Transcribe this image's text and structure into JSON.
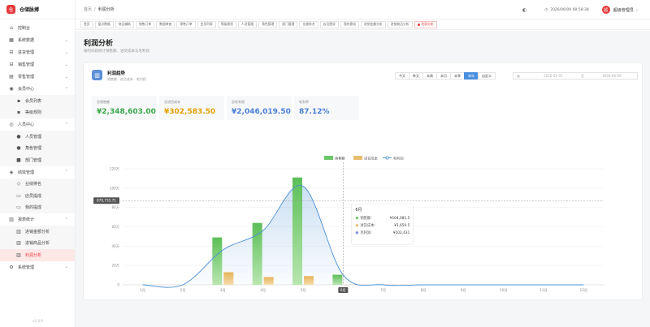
{
  "app": {
    "name": "仓储脉搏",
    "logo": "仓"
  },
  "sidebar": {
    "items": [
      {
        "label": "控制台",
        "icon": "home-icon",
        "glyph": "⌂"
      },
      {
        "label": "系统数据",
        "icon": "grid-icon",
        "glyph": "▦",
        "chevron": "⌄"
      },
      {
        "label": "进货管理",
        "icon": "cart-icon",
        "glyph": "⊟",
        "chevron": "⌄"
      },
      {
        "label": "销售管理",
        "icon": "bag-icon",
        "glyph": "⊟",
        "chevron": "⌄"
      },
      {
        "label": "零售管理",
        "icon": "store-icon",
        "glyph": "▤",
        "chevron": "⌄"
      },
      {
        "label": "会员中心",
        "icon": "member-icon",
        "glyph": "◉",
        "chevron": "⌃",
        "children": [
          {
            "label": "会员列表",
            "glyph": "▪"
          },
          {
            "label": "等级规则",
            "glyph": "▪"
          }
        ]
      },
      {
        "label": "人员中心",
        "icon": "people-icon",
        "glyph": "◎",
        "chevron": "⌃",
        "children": [
          {
            "label": "人员管理",
            "glyph": "●"
          },
          {
            "label": "角色管理",
            "glyph": "●"
          },
          {
            "label": "部门管理",
            "glyph": "■"
          }
        ]
      },
      {
        "label": "绩效管理",
        "icon": "medal-icon",
        "glyph": "◈",
        "chevron": "⌃",
        "children": [
          {
            "label": "业绩排名",
            "glyph": "◇"
          },
          {
            "label": "店员提成",
            "glyph": "▭"
          },
          {
            "label": "我的提成",
            "glyph": "▭"
          }
        ]
      },
      {
        "label": "报表统计",
        "icon": "report-icon",
        "glyph": "▥",
        "chevron": "⌃",
        "children": [
          {
            "label": "进销金额分析",
            "glyph": "▥"
          },
          {
            "label": "进销商品分析",
            "glyph": "▥"
          },
          {
            "label": "利润分析",
            "glyph": "▥",
            "active": true
          }
        ]
      },
      {
        "label": "系统管理",
        "icon": "gear-icon",
        "glyph": "⚙",
        "chevron": "⌄"
      }
    ],
    "version": "v1.3.0"
  },
  "header": {
    "breadcrumb": [
      "首页",
      "利润分析"
    ],
    "sep": "/",
    "datetime": "2026/06/09  08:58:38",
    "user": "超级管理员",
    "avatar": "超",
    "theme_glyph": "◐",
    "clock_glyph": "◷",
    "user_chevron": "⌄"
  },
  "tabs": [
    "首页",
    "盘点数据",
    "商品辅助",
    "销售订单",
    "数据审查",
    "零售订单",
    "会员列表",
    "等级规则",
    "人员管理",
    "角色管理",
    "部门管理",
    "业绩排名",
    "店员提成",
    "我的提成",
    "进销金额分析",
    "进销商品分析",
    "利润分析"
  ],
  "active_tab": "利润分析",
  "page": {
    "title": "利润分析",
    "subtitle": "按时间段统计销售额、进货成本与毛利润"
  },
  "card": {
    "icon_glyph": "▥",
    "title": "利润趋势",
    "subtitle": "销售额 · 进货成本 · 毛利润",
    "periods": [
      "今天",
      "昨天",
      "本周",
      "本月",
      "本季",
      "本年",
      "自定义"
    ],
    "active_period": "本年",
    "date_icon": "▦",
    "start_date": "2026-01-01",
    "range_sep": "至",
    "end_date": "2026-06-09"
  },
  "kpis": [
    {
      "label": "总销售额",
      "value": "¥2,348,603.00",
      "color": "#3aa84a"
    },
    {
      "label": "总进货成本",
      "value": "¥302,583.50",
      "color": "#e5a100"
    },
    {
      "label": "总毛利润",
      "value": "¥2,046,019.50",
      "color": "#4a7fd6"
    },
    {
      "label": "毛利率",
      "value": "87.12%",
      "color": "#4a7fd6"
    }
  ],
  "colors": {
    "accent": "#e4393c",
    "sales": "#6cc568",
    "cost": "#e9bd6e",
    "profit": "#4a90d6"
  },
  "chart_data": {
    "type": "bar",
    "categories": [
      "1月",
      "2月",
      "3月",
      "4月",
      "5月",
      "6月",
      "7月",
      "8月",
      "9月",
      "10月",
      "11月",
      "12月"
    ],
    "series": [
      {
        "name": "销售额",
        "type": "bar",
        "values": [
          0,
          0,
          490000,
          640000,
          1110000,
          104081.5,
          0,
          0,
          0,
          0,
          0,
          0
        ]
      },
      {
        "name": "进货成本",
        "type": "bar",
        "values": [
          0,
          0,
          130000,
          80000,
          90000,
          1650.5,
          0,
          0,
          0,
          0,
          0,
          0
        ]
      },
      {
        "name": "毛利润",
        "type": "line",
        "values": [
          0,
          0,
          360000,
          560000,
          1020000,
          102431,
          0,
          0,
          0,
          0,
          0,
          0
        ]
      }
    ],
    "y_ticks": [
      "0",
      "20万",
      "40万",
      "60万",
      "80万",
      "100万",
      "120万"
    ],
    "ylim": [
      0,
      1200000
    ],
    "crosshair_value": 870733.71,
    "crosshair_label": "870,733.71",
    "hover_category": "6月",
    "tooltip": {
      "title": "6月",
      "rows": [
        {
          "label": "销售额:",
          "value": "¥104,081.5",
          "color": "#6cc568"
        },
        {
          "label": "进货成本:",
          "value": "¥1,650.5",
          "color": "#e9bd6e"
        },
        {
          "label": "毛利润:",
          "value": "¥102,431",
          "color": "#7b8fd6"
        }
      ]
    },
    "legend_position": "top-center"
  }
}
